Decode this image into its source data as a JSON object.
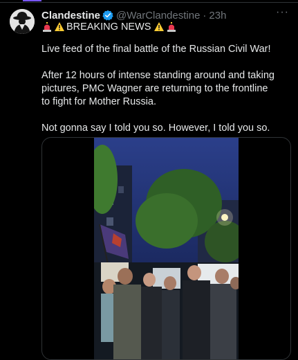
{
  "tweet": {
    "author_name": "Clandestine",
    "author_handle": "@WarClandestine",
    "separator": "·",
    "timestamp": "23h",
    "more_label": "···",
    "headline": "BREAKING NEWS",
    "paragraphs": [
      "Live feed of the final battle of the Russian Civil War!",
      "After 12 hours of intense standing around and taking pictures, PMC Wagner are returning to the frontline to fight for Mother Russia.",
      "Not gonna say I told you so. However, I told you so."
    ]
  },
  "colors": {
    "background": "#000000",
    "text": "#e7e9ea",
    "muted": "#71767b",
    "verified": "#1d9bf0",
    "border": "#2f3336"
  },
  "icons": [
    "siren-icon",
    "warning-icon",
    "verified-badge-icon",
    "more-icon"
  ]
}
